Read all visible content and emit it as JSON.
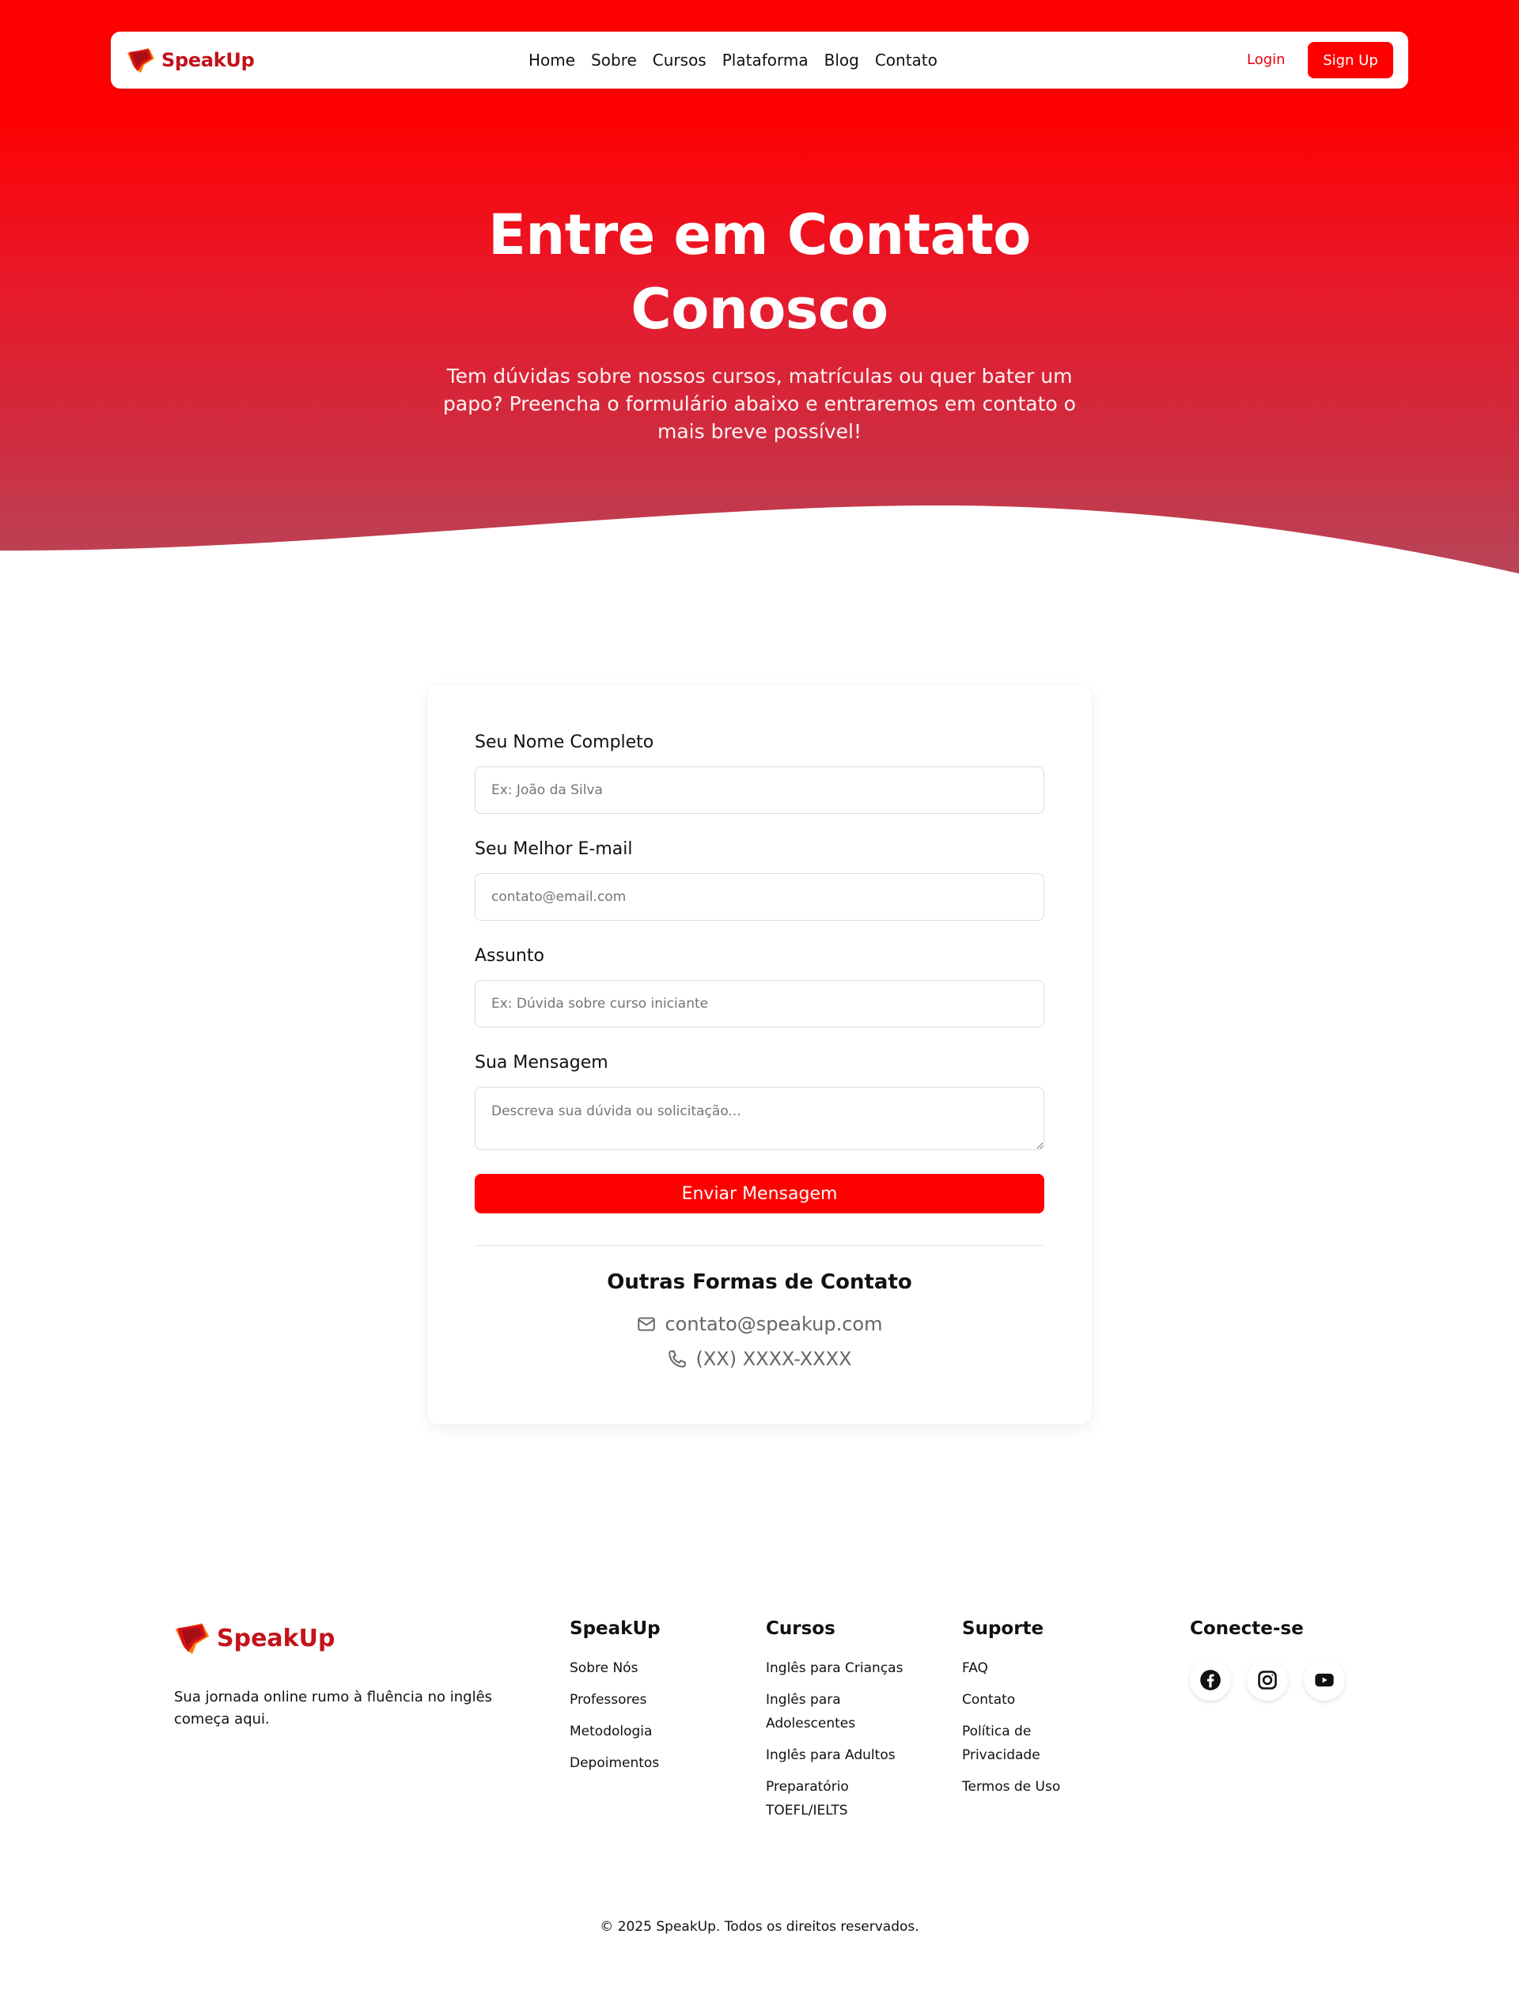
{
  "brand": {
    "name": "SpeakUp"
  },
  "nav": {
    "links": [
      "Home",
      "Sobre",
      "Cursos",
      "Plataforma",
      "Blog",
      "Contato"
    ],
    "login_label": "Login",
    "signup_label": "Sign Up"
  },
  "hero": {
    "title": "Entre em Contato Conosco",
    "subtitle": "Tem dúvidas sobre nossos cursos, matrículas ou quer bater um papo? Preencha o formulário abaixo e entraremos em contato o mais breve possível!"
  },
  "form": {
    "name_label": "Seu Nome Completo",
    "name_placeholder": "Ex: João da Silva",
    "email_label": "Seu Melhor E-mail",
    "email_placeholder": "contato@email.com",
    "subject_label": "Assunto",
    "subject_placeholder": "Ex: Dúvida sobre curso iniciante",
    "message_label": "Sua Mensagem",
    "message_placeholder": "Descreva sua dúvida ou solicitação...",
    "submit_label": "Enviar Mensagem"
  },
  "other_contact": {
    "title": "Outras Formas de Contato",
    "email": "contato@speakup.com",
    "phone": "(XX) XXXX-XXXX"
  },
  "footer": {
    "tagline": "Sua jornada online rumo à fluência no inglês começa aqui.",
    "columns": [
      {
        "title": "SpeakUp",
        "items": [
          "Sobre Nós",
          "Professores",
          "Metodologia",
          "Depoimentos"
        ]
      },
      {
        "title": "Cursos",
        "items": [
          "Inglês para Crianças",
          "Inglês para Adolescentes",
          "Inglês para Adultos",
          "Preparatório TOEFL/IELTS"
        ]
      },
      {
        "title": "Suporte",
        "items": [
          "FAQ",
          "Contato",
          "Política de Privacidade",
          "Termos de Uso"
        ]
      }
    ],
    "connect_title": "Conecte-se",
    "social_icons": [
      "facebook-icon",
      "instagram-icon",
      "youtube-icon"
    ],
    "copyright": "© 2025 SpeakUp. Todos os direitos reservados."
  },
  "colors": {
    "brand_red": "#ff0000",
    "logo_red": "#c4121a"
  }
}
